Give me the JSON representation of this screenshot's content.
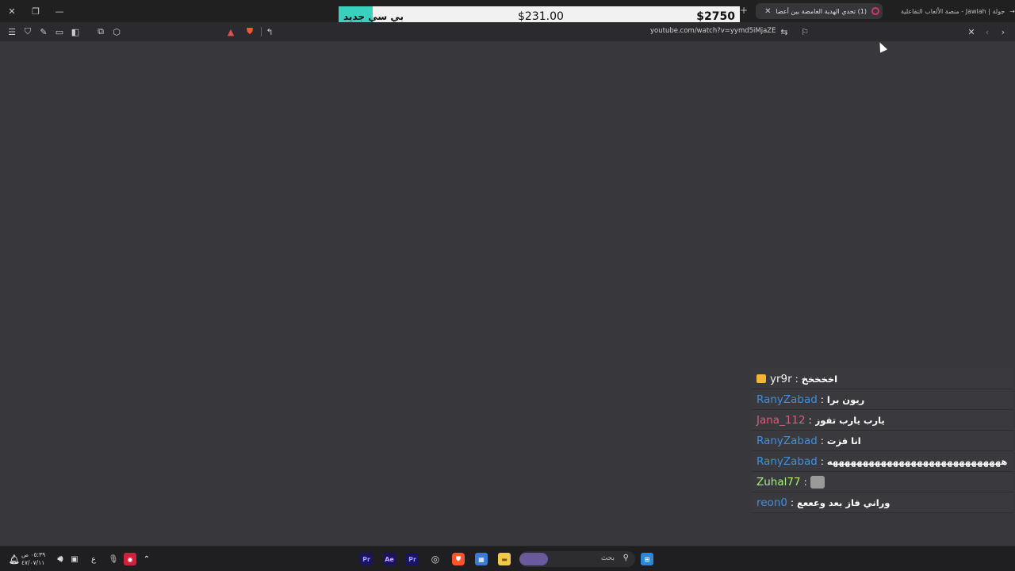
{
  "window": {
    "close_icon": "close-icon",
    "restore_icon": "restore-icon",
    "minimize_icon": "minimize-icon"
  },
  "tabs": [
    {
      "label": "(1) تحدي الهدية الغامضة بين أعضا",
      "active": true
    },
    {
      "label": "جولة | Jawlah - منصة الألعاب التفاعلية",
      "active": false
    }
  ],
  "prize": {
    "label": "بي سي جديد",
    "current": "$231.00",
    "goal": "$2750",
    "progress_fraction": 0.084,
    "fill_color": "#37d1bd"
  },
  "toolbar": {
    "url": "youtube.com/watch?v=yymd5iMjaZE"
  },
  "chat": [
    {
      "user": "yr9r",
      "message": "اخخخخخ",
      "color": "#f2f2f2",
      "badge": "crown-icon"
    },
    {
      "user": "RanyZabad",
      "message": "ريون برا",
      "color": "#3d8fe0"
    },
    {
      "user": "Jana_112",
      "message": "يارب يارب تفوز",
      "color": "#e05a79"
    },
    {
      "user": "RanyZabad",
      "message": "انا فزت",
      "color": "#3d8fe0"
    },
    {
      "user": "RanyZabad",
      "message": "هههههههههههههههههههههههههههههه",
      "color": "#3d8fe0"
    },
    {
      "user": "Zuhal77",
      "message": "",
      "color": "#a6f07a",
      "emote": "cat-emote-icon"
    },
    {
      "user": "reon0",
      "message": "وراني فاز بعد وعععع",
      "color": "#3d8fe0"
    }
  ],
  "taskbar": {
    "search_placeholder": "بحث",
    "clock_time": "٠٥:٣٩ ص",
    "clock_date": "٤٧/٠٧/١١",
    "lang": "ع"
  }
}
